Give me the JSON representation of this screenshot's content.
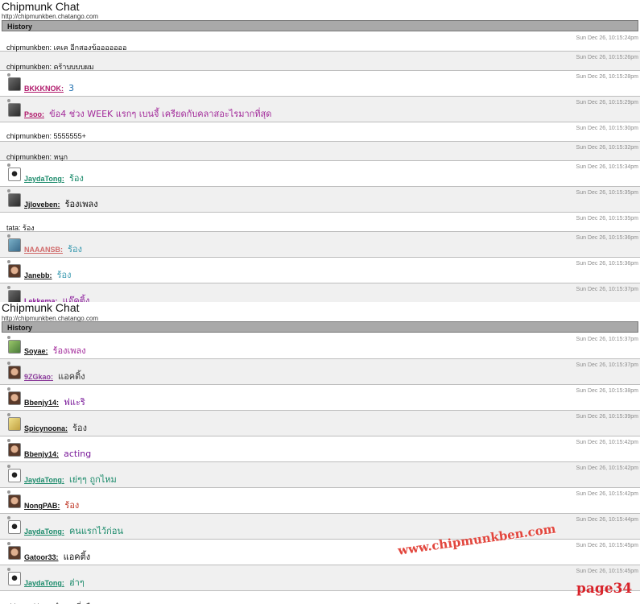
{
  "colors": {
    "history_bar": "#a9a9a9",
    "row_alt": "#f0f0f0",
    "timestamp": "#8b8b8b",
    "watermark": "#e2463d",
    "page_label": "#d8242b"
  },
  "screens": [
    {
      "title": "Chipmunk Chat",
      "url": "http://chipmunkben.chatango.com",
      "history_label": "History",
      "messages": [
        {
          "type": "plain",
          "text": "chipmunkben: เคเค อีกสองข้อออออออ",
          "time": "Sun Dec 26, 10:15:24pm"
        },
        {
          "type": "plain",
          "text": "chipmunkben: คร้าบบบบผม",
          "time": "Sun Dec 26, 10:15:26pm"
        },
        {
          "type": "user",
          "user": "BKKKNOK:",
          "text": "3",
          "time": "Sun Dec 26, 10:15:28pm",
          "ucolor": "#b0186a",
          "mcolor": "#2070b0",
          "avatar": "avatar-dark-icon"
        },
        {
          "type": "user",
          "user": "Psoo:",
          "text": "ข้อ4 ช่วง WEEK แรกๆ เบนจี้ เครียดกับคลาสอะไรมากที่สุด",
          "time": "Sun Dec 26, 10:15:29pm",
          "ucolor": "#b0186a",
          "mcolor": "#a22a9a",
          "avatar": "avatar-dark-icon"
        },
        {
          "type": "plain",
          "text": "chipmunkben: 5555555+",
          "time": "Sun Dec 26, 10:15:30pm"
        },
        {
          "type": "plain",
          "text": "chipmunkben: หนุก",
          "time": "Sun Dec 26, 10:15:32pm"
        },
        {
          "type": "user",
          "user": "JaydaTong:",
          "text": "ร้อง",
          "time": "Sun Dec 26, 10:15:34pm",
          "ucolor": "#1a8a6a",
          "mcolor": "#1a8a6a",
          "avatar": "avatar-white-icon"
        },
        {
          "type": "user",
          "user": "Jjloveben:",
          "text": "ร้องเพลง",
          "time": "Sun Dec 26, 10:15:35pm",
          "ucolor": "#111111",
          "mcolor": "#111111",
          "avatar": "avatar-dark-icon"
        },
        {
          "type": "plain",
          "text": "tata: ร้อง",
          "time": "Sun Dec 26, 10:15:35pm"
        },
        {
          "type": "user",
          "user": "NAAANSB:",
          "text": "ร้อง",
          "time": "Sun Dec 26, 10:15:36pm",
          "ucolor": "#d06a6a",
          "mcolor": "#3a9ab0",
          "avatar": "avatar-teal-icon"
        },
        {
          "type": "user",
          "user": "Janebb:",
          "text": "ร้อง",
          "time": "Sun Dec 26, 10:15:36pm",
          "ucolor": "#111111",
          "mcolor": "#3a9ab0",
          "avatar": "avatar-face-icon"
        },
        {
          "type": "user",
          "user": "Lekkema:",
          "text": "แอ๊คติ้ง",
          "time": "Sun Dec 26, 10:15:37pm",
          "ucolor": "#8a1a9a",
          "mcolor": "#8a1a9a",
          "avatar": "avatar-dark-icon"
        }
      ]
    },
    {
      "title": "Chipmunk Chat",
      "url": "http://chipmunkben.chatango.com",
      "history_label": "History",
      "messages": [
        {
          "type": "user",
          "user": "Soyae:",
          "text": "ร้องเพลง",
          "time": "Sun Dec 26, 10:15:37pm",
          "ucolor": "#111111",
          "mcolor": "#a22a9a",
          "avatar": "avatar-green-icon"
        },
        {
          "type": "user",
          "user": "9ZGkao:",
          "text": "แอคติ้ง",
          "time": "Sun Dec 26, 10:15:37pm",
          "ucolor": "#8a3a9a",
          "mcolor": "#333333",
          "avatar": "avatar-face-icon"
        },
        {
          "type": "user",
          "user": "Bbenjy14:",
          "text": "ฟแะริ",
          "time": "Sun Dec 26, 10:15:38pm",
          "ucolor": "#111111",
          "mcolor": "#7a1a9a",
          "avatar": "avatar-face-icon"
        },
        {
          "type": "user",
          "user": "Spicynoona:",
          "text": "ร้อง",
          "time": "Sun Dec 26, 10:15:39pm",
          "ucolor": "#111111",
          "mcolor": "#333333",
          "avatar": "avatar-yellow-icon"
        },
        {
          "type": "user",
          "user": "Bbenjy14:",
          "text": "acting",
          "time": "Sun Dec 26, 10:15:42pm",
          "ucolor": "#111111",
          "mcolor": "#7a1a9a",
          "avatar": "avatar-face-icon"
        },
        {
          "type": "user",
          "user": "JaydaTong:",
          "text": "เย่ๆๆ ถูกไหม",
          "time": "Sun Dec 26, 10:15:42pm",
          "ucolor": "#1a8a6a",
          "mcolor": "#1a8a6a",
          "avatar": "avatar-white-icon"
        },
        {
          "type": "user",
          "user": "NongPAB:",
          "text": "ร้อง",
          "time": "Sun Dec 26, 10:15:42pm",
          "ucolor": "#111111",
          "mcolor": "#c03a2a",
          "avatar": "avatar-face-icon"
        },
        {
          "type": "user",
          "user": "JaydaTong:",
          "text": "คนแรกไว้ก่อน",
          "time": "Sun Dec 26, 10:15:44pm",
          "ucolor": "#1a8a6a",
          "mcolor": "#1a8a6a",
          "avatar": "avatar-white-icon"
        },
        {
          "type": "user",
          "user": "Gatoor33:",
          "text": "แอคติ้ง",
          "time": "Sun Dec 26, 10:15:45pm",
          "ucolor": "#111111",
          "mcolor": "#111111",
          "avatar": "avatar-face-icon"
        },
        {
          "type": "user",
          "user": "JaydaTong:",
          "text": "ฮ่าๆ",
          "time": "Sun Dec 26, 10:15:45pm",
          "ucolor": "#1a8a6a",
          "mcolor": "#1a8a6a",
          "avatar": "avatar-white-icon"
        },
        {
          "type": "plain",
          "text": "chipmunkben: คำตอบที่ถูคือออออออออออออออออออออ...............................",
          "time": ""
        }
      ]
    }
  ],
  "watermark": "www.chipmunkben.com",
  "page_label": "page34"
}
